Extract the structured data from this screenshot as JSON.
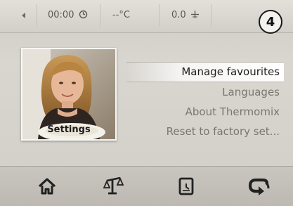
{
  "status_bar": {
    "time": "00:00",
    "time_icon": "clock-icon",
    "temperature": "--°C",
    "weight": "0.0",
    "weight_icon": "scale-cross-icon",
    "back_icon": "back-arrow-icon"
  },
  "step_badge": "4",
  "thumbnail": {
    "label": "Settings"
  },
  "menu": {
    "items": [
      {
        "label": "Manage favourites",
        "selected": true
      },
      {
        "label": "Languages",
        "selected": false
      },
      {
        "label": "About Thermomix",
        "selected": false
      },
      {
        "label": "Reset to factory set...",
        "selected": false
      }
    ]
  },
  "toolbar": {
    "buttons": [
      {
        "icon": "home-icon"
      },
      {
        "icon": "scale-icon"
      },
      {
        "icon": "timer-icon"
      },
      {
        "icon": "return-icon"
      }
    ]
  },
  "colors": {
    "background": "#d2cec8",
    "selected_text": "#1e1d1b",
    "menu_text": "#7a7670",
    "icon_dark": "#222222"
  }
}
